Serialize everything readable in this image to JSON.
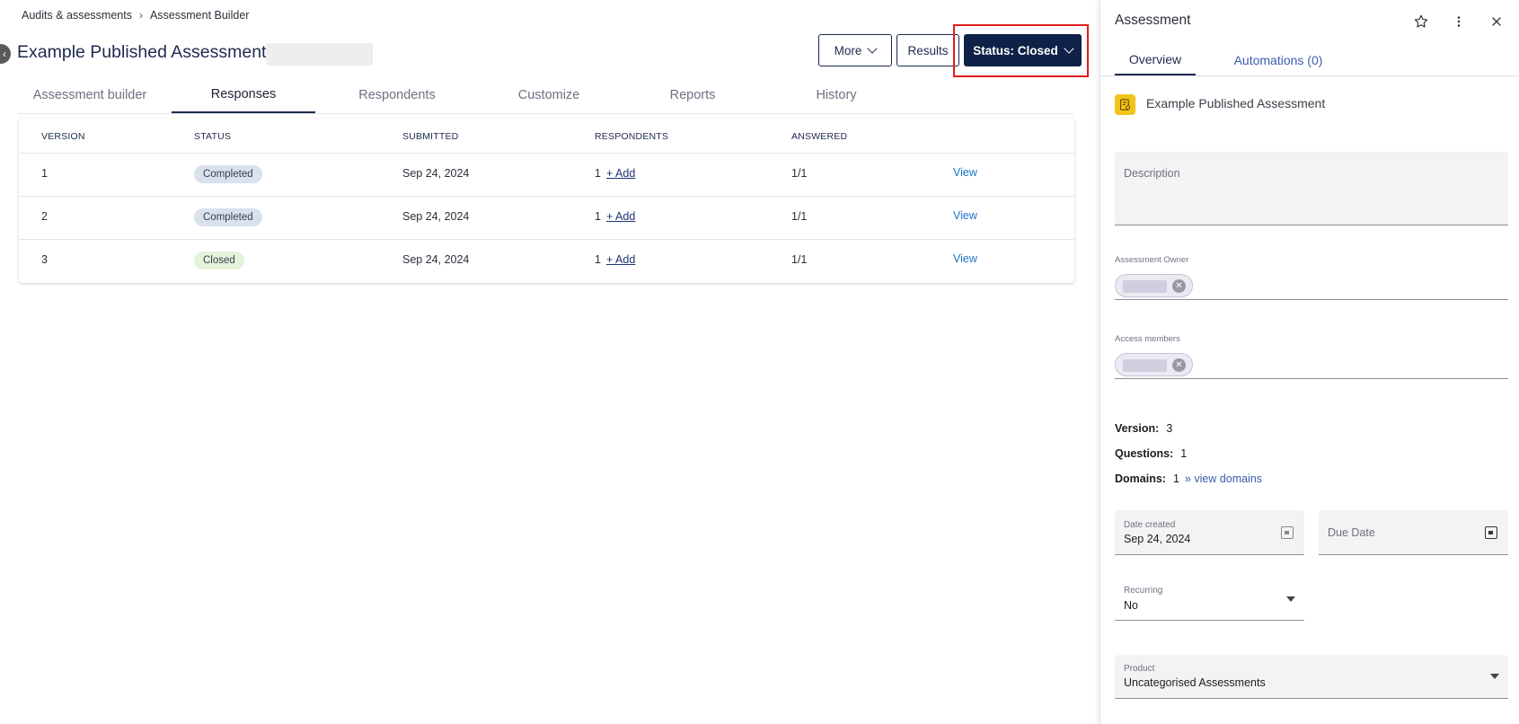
{
  "breadcrumb": {
    "items": [
      "Audits & assessments",
      "Assessment Builder"
    ],
    "separator": ">"
  },
  "header": {
    "title": "Example Published Assessment",
    "more_label": "More",
    "results_label": "Results",
    "status_label": "Status: Closed"
  },
  "tabs": [
    "Assessment builder",
    "Responses",
    "Respondents",
    "Customize",
    "Reports",
    "History"
  ],
  "active_tab": "Responses",
  "table": {
    "headers": [
      "VERSION",
      "STATUS",
      "SUBMITTED",
      "RESPONDENTS",
      "ANSWERED"
    ],
    "rows": [
      {
        "version": "1",
        "status": "Completed",
        "submitted": "Sep 24, 2024",
        "respondents": "1",
        "add": "+ Add",
        "answered": "1/1",
        "action": "View"
      },
      {
        "version": "2",
        "status": "Completed",
        "submitted": "Sep 24, 2024",
        "respondents": "1",
        "add": "+ Add",
        "answered": "1/1",
        "action": "View"
      },
      {
        "version": "3",
        "status": "Closed",
        "submitted": "Sep 24, 2024",
        "respondents": "1",
        "add": "+ Add",
        "answered": "1/1",
        "action": "View"
      }
    ]
  },
  "panel": {
    "title": "Assessment",
    "tabs": {
      "overview": "Overview",
      "automations": "Automations (0)"
    },
    "assessment_name": "Example Published Assessment",
    "description_placeholder": "Description",
    "owner_label": "Assessment Owner",
    "access_label": "Access members",
    "version_key": "Version:",
    "version_value": "3",
    "questions_key": "Questions:",
    "questions_value": "1",
    "domains_key": "Domains:",
    "domains_value": "1",
    "domains_link": "» view domains",
    "date_created_label": "Date created",
    "date_created_value": "Sep 24, 2024",
    "due_date_placeholder": "Due Date",
    "recurring_label": "Recurring",
    "recurring_value": "No",
    "product_label": "Product",
    "product_value": "Uncategorised Assessments"
  },
  "colors": {
    "primary_navy": "#0f2147",
    "highlight_red": "#e01b1b",
    "link_blue": "#1a73c9",
    "completed_chip": "#d8e1ec",
    "closed_chip": "#e3f2d9",
    "assessment_icon": "#f0c419"
  },
  "icons": [
    "back-icon",
    "chevron-right-icon",
    "chevron-down-icon",
    "star-icon",
    "more-vertical-icon",
    "close-icon",
    "assessment-icon",
    "calendar-icon",
    "dropdown-arrow-icon",
    "remove-chip-icon"
  ]
}
